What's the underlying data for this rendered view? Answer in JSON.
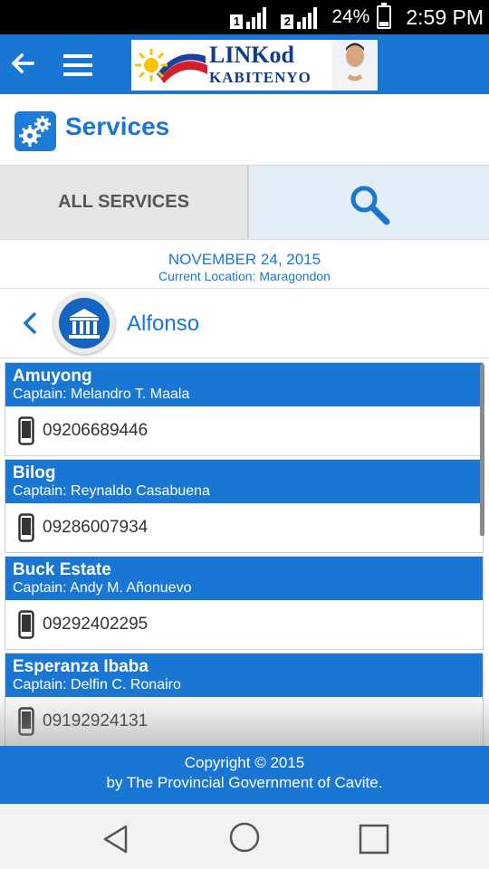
{
  "status_bar": {
    "sim1": "1",
    "sim2": "2",
    "battery": "24%",
    "time": "2:59 PM"
  },
  "app_bar": {
    "logo_title": "LINKod",
    "logo_subtitle": "KABITENYO"
  },
  "section": {
    "title": "Services"
  },
  "tabs": {
    "all_services": "ALL SERVICES"
  },
  "info": {
    "date": "NOVEMBER 24, 2015",
    "location": "Current Location: Maragondon"
  },
  "town": {
    "name": "Alfonso"
  },
  "barangays": [
    {
      "name": "Amuyong",
      "captain": "Captain: Melandro T. Maala",
      "phone": "09206689446"
    },
    {
      "name": "Bilog",
      "captain": "Captain: Reynaldo Casabuena",
      "phone": "09286007934"
    },
    {
      "name": "Buck Estate",
      "captain": "Captain: Andy M. Añonuevo",
      "phone": "09292402295"
    },
    {
      "name": "Esperanza Ibaba",
      "captain": "Captain: Delfin C. Ronairo",
      "phone": "09192924131"
    }
  ],
  "footer": {
    "line1": "Copyright © 2015",
    "line2": "by The Provincial Government of Cavite."
  },
  "colors": {
    "primary": "#1976d2",
    "status_bar": "#000000",
    "tab_inactive": "#e6e6e6",
    "tab_search": "#e3eef8"
  },
  "icons": [
    "back-arrow-icon",
    "menu-icon",
    "gear-icon",
    "search-icon",
    "chevron-left-icon",
    "town-hall-icon",
    "mobile-phone-icon",
    "nav-back-icon",
    "nav-home-icon",
    "nav-recent-icon"
  ]
}
